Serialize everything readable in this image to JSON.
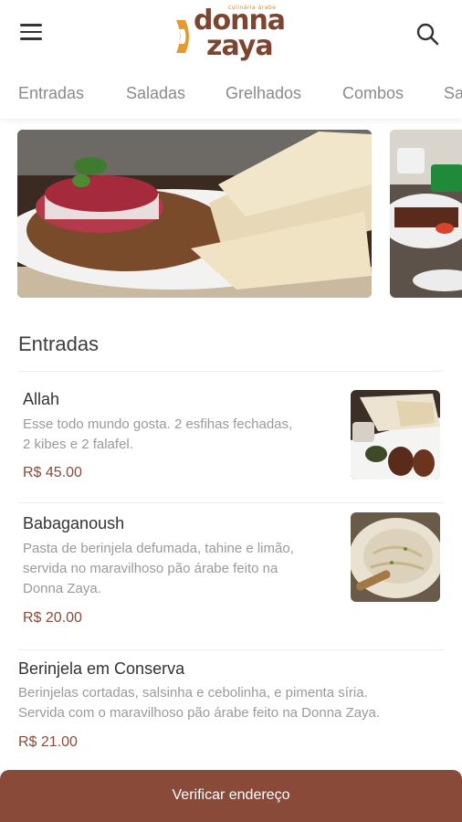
{
  "header": {
    "logo_tagline": "culinária árabe",
    "logo_line1": "donna",
    "logo_line2": "zaya",
    "menu_icon": "hamburger-menu-icon",
    "search_icon": "search-icon"
  },
  "tabs": [
    "Entradas",
    "Saladas",
    "Grelhados",
    "Combos",
    "Sa"
  ],
  "section": {
    "title": "Entradas"
  },
  "items": [
    {
      "name": "Allah",
      "desc_lines": [
        "Esse todo mundo gosta. 2 esfihas fechadas,",
        "2 kibes e 2 falafel."
      ],
      "price": "R$ 45.00"
    },
    {
      "name": "Babaganoush",
      "desc_lines": [
        "Pasta de berinjela defumada, tahine e limão,",
        "servida no maravilhoso pão árabe feito na",
        "Donna Zaya."
      ],
      "price": "R$ 20.00"
    },
    {
      "name": "Berinjela em Conserva",
      "desc_lines": [
        "Berinjelas cortadas, salsinha e cebolinha, e pimenta síria.",
        "Servida com o maravilhoso pão árabe feito na Donna Zaya."
      ],
      "price": "R$ 21.00"
    }
  ],
  "bottom_button": {
    "label": "Verificar endereço"
  },
  "colors": {
    "brand_brown": "#7d4430",
    "brand_orange": "#e39a2f",
    "price": "#8a4a38",
    "button_bg": "#8a4a3a"
  }
}
